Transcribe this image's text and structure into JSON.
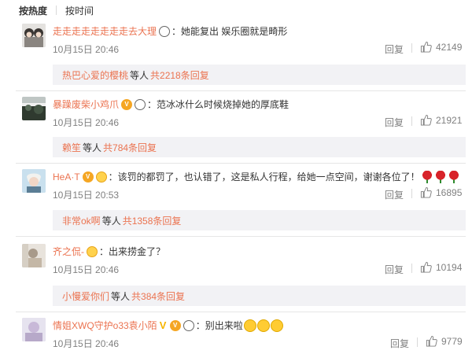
{
  "sort": {
    "hot": "按热度",
    "time": "按时间"
  },
  "common": {
    "reply": "回复",
    "etc": "等人"
  },
  "comments": [
    {
      "user": "走走走走走走走走去大理",
      "text": "：她能复出 娱乐圈就是畸形",
      "time": "10月15日 20:46",
      "likes": "42149",
      "sub_name": "热巴心爱的樱桃",
      "sub_total": "共2218条回复"
    },
    {
      "user": "暴躁废柴小鸡爪",
      "text": "：范冰冰什么时候烧掉她的厚底鞋",
      "time": "10月15日 20:46",
      "likes": "21921",
      "sub_name": "赖笙",
      "sub_total": "共784条回复"
    },
    {
      "user": "HeA·T",
      "text": "：该罚的都罚了，也认错了，这是私人行程，给她一点空间，谢谢各位了！",
      "time": "10月15日 20:53",
      "likes": "16895",
      "sub_name": "非常ok啊",
      "sub_total": "共1358条回复"
    },
    {
      "user": "齐之侃-",
      "text": "：出来捞金了？",
      "time": "10月15日 20:46",
      "likes": "10194",
      "sub_name": "小慢爱你们",
      "sub_total": "共384条回复"
    },
    {
      "user": "情姐XWQ守护o33袁小陌",
      "text": "：别出来啦",
      "time": "10月15日 20:46",
      "likes": "9779"
    }
  ],
  "colors": {
    "link": "#eb7350",
    "muted": "#808080",
    "subbox": "#f2f2f5"
  },
  "icons": [
    "thumb-up-icon",
    "panda-emoji-icon",
    "vip-badge-icon",
    "rose-emoji-icon",
    "smile-emoji-icon",
    "v-verified-icon"
  ]
}
